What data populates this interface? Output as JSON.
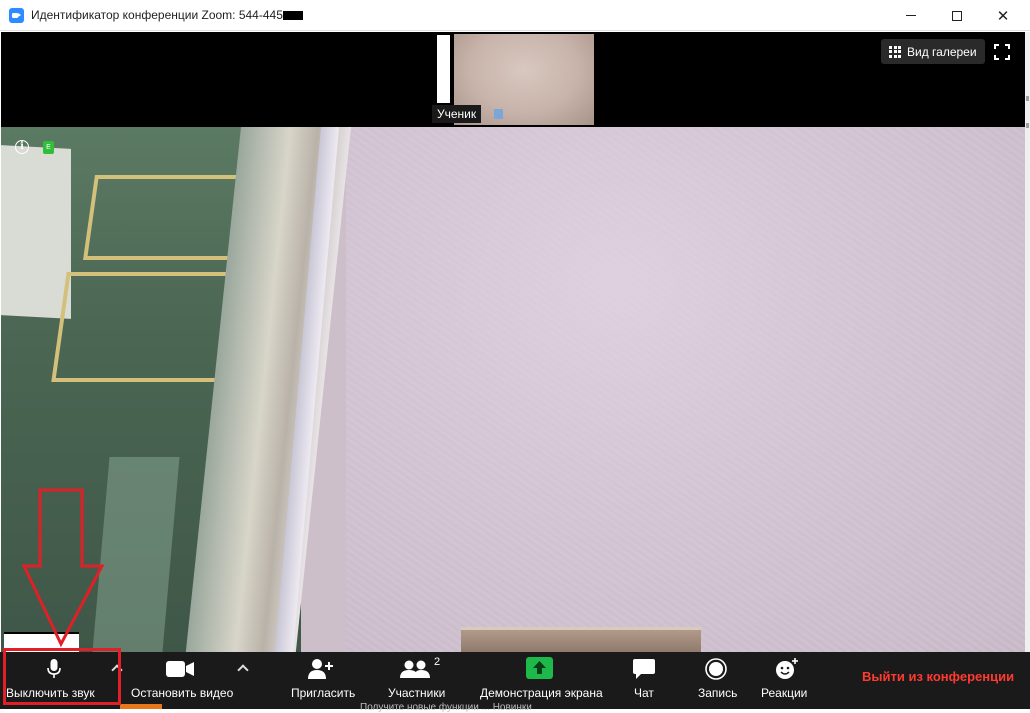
{
  "window": {
    "title": "Идентификатор конференции Zoom: 544-445-",
    "minimize_label": "",
    "maximize_label": "",
    "close_label": "✕"
  },
  "top_strip": {
    "thumbnail_name": "Ученик",
    "gallery_view_label": "Вид галереи"
  },
  "main_video": {
    "info_symbol": "i",
    "encryption_badge": "E"
  },
  "toolbar": {
    "mute_label": "Выключить звук",
    "stop_video_label": "Остановить видео",
    "invite_label": "Пригласить",
    "participants_label": "Участники",
    "participants_count": "2",
    "share_screen_label": "Демонстрация экрана",
    "chat_label": "Чат",
    "record_label": "Запись",
    "reactions_label": "Реакции",
    "leave_label": "Выйти из конференции"
  },
  "taskbar_hint": "Получите новые функции ... Новинки",
  "colors": {
    "toolbar_bg": "#1a1a1a",
    "leave_red": "#ff3b30",
    "share_green": "#1db94b",
    "annotation_red": "#e01f26",
    "zoom_blue": "#2d8cff"
  },
  "icons": {
    "mute": "microphone-icon",
    "video": "video-camera-icon",
    "invite": "add-person-icon",
    "participants": "people-icon",
    "share": "share-screen-arrow-icon",
    "chat": "speech-bubble-icon",
    "record": "record-circle-icon",
    "reactions": "smiley-plus-icon",
    "gallery": "grid-icon",
    "fullscreen": "fullscreen-icon"
  }
}
